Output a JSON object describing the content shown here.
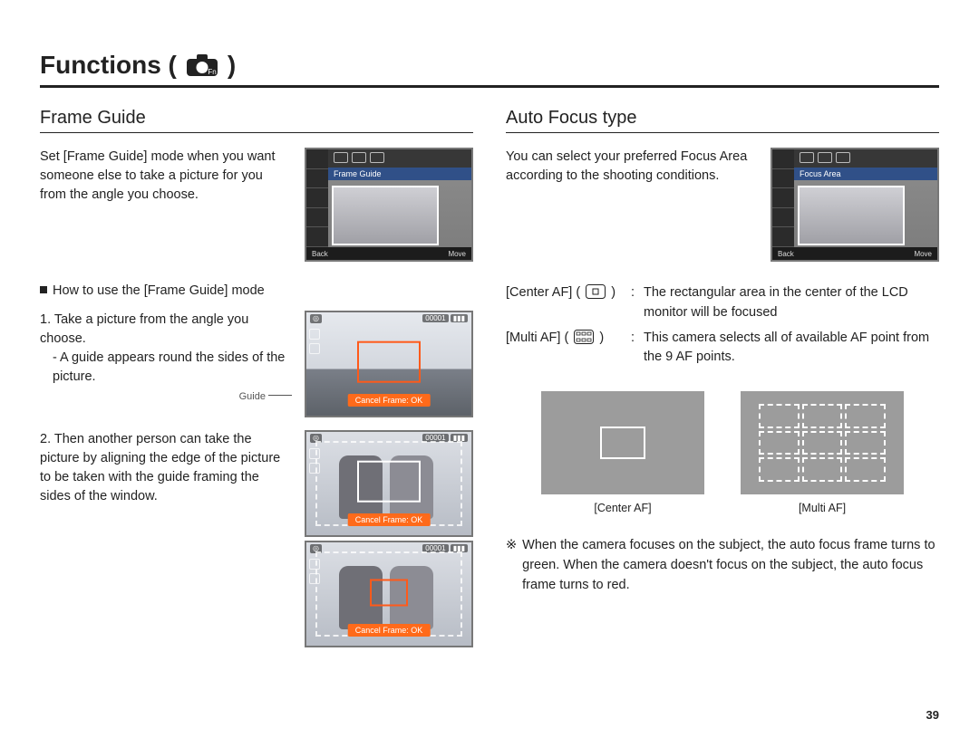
{
  "title": {
    "text": "Functions (",
    "close": ")"
  },
  "page_number": "39",
  "left": {
    "heading": "Frame Guide",
    "intro": "Set [Frame Guide] mode when you want someone else to take a picture for you from the angle you choose.",
    "menu_label": "Frame Guide",
    "menu_back": "Back",
    "menu_move": "Move",
    "howto_heading": "How to use the [Frame Guide] mode",
    "guide_annotation": "Guide",
    "step1": "1. Take a picture from the angle you choose.",
    "step1_sub": "- A guide appears round the sides of the picture.",
    "step2": "2. Then another person can take the picture by aligning the edge of the picture to be taken with the guide framing the sides of the window.",
    "thumb_counter": "00001",
    "cancel_label": "Cancel Frame: OK"
  },
  "right": {
    "heading": "Auto Focus type",
    "intro": "You can select your preferred Focus Area according to the shooting conditions.",
    "menu_label": "Focus Area",
    "menu_back": "Back",
    "menu_move": "Move",
    "rows": [
      {
        "key": "[Center AF] (",
        "key_close": ")",
        "desc": "The rectangular area in the center of the LCD monitor will be focused"
      },
      {
        "key": "[Multi AF] (",
        "key_close": ")",
        "desc": "This camera selects all of available AF point from the 9 AF points."
      }
    ],
    "caption_center": "[Center AF]",
    "caption_multi": "[Multi AF]",
    "note_mark": "※",
    "note": "When the camera focuses on the subject, the auto focus frame turns to green. When the camera doesn't focus on the subject, the auto focus frame turns to red."
  }
}
